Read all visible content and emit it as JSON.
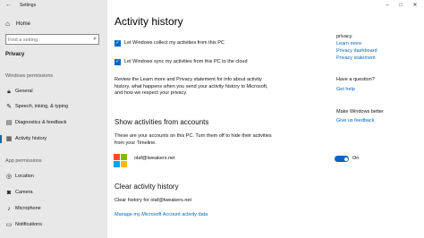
{
  "window": {
    "title": "Settings",
    "back_glyph": "←",
    "min_glyph": "–",
    "max_glyph": "□",
    "close_glyph": "✕"
  },
  "sidebar": {
    "home_label": "Home",
    "search_placeholder": "Find a setting",
    "category": "Privacy",
    "windows_permissions_header": "Windows permissions",
    "app_permissions_header": "App permissions",
    "windows_items": [
      {
        "label": "General",
        "icon": "lock-icon"
      },
      {
        "label": "Speech, inking, & typing",
        "icon": "pen-icon"
      },
      {
        "label": "Diagnostics & feedback",
        "icon": "feedback-icon"
      },
      {
        "label": "Activity history",
        "icon": "history-icon"
      }
    ],
    "app_items": [
      {
        "label": "Location",
        "icon": "location-icon"
      },
      {
        "label": "Camera",
        "icon": "camera-icon"
      },
      {
        "label": "Microphone",
        "icon": "microphone-icon"
      },
      {
        "label": "Notifications",
        "icon": "notifications-icon"
      }
    ]
  },
  "main": {
    "title": "Activity history",
    "check1_label": "Let Windows collect my activities from this PC",
    "check2_label": "Let Windows sync my activities from this PC to the cloud",
    "review_text": "Review the Learn more and Privacy statement for info about activity history, what happens when you send your activity history to Microsoft, and how we respect your privacy.",
    "accounts_heading": "Show activities from accounts",
    "accounts_desc": "These are your accounts on this PC. Turn them off to hide their activities from your Timeline.",
    "account_email": "olaf@tweakers.net",
    "toggle_state": "On",
    "clear_heading": "Clear activity history",
    "clear_for": "Clear history for olaf@tweakers.net",
    "manage_link": "Manage my Microsoft Account activity data"
  },
  "right": {
    "privacy_snippet": "privacy.",
    "learn_more": "Learn more",
    "privacy_dashboard": "Privacy dashboard",
    "privacy_statement": "Privacy statement",
    "question": "Have a question?",
    "get_help": "Get help",
    "make_better": "Make Windows better",
    "feedback": "Give us feedback"
  },
  "colors": {
    "accent": "#0067c0",
    "sidebar_bg": "#e8e8e8",
    "ms_red": "#f25022",
    "ms_green": "#7fba00",
    "ms_blue": "#00a4ef",
    "ms_yellow": "#ffb900"
  }
}
